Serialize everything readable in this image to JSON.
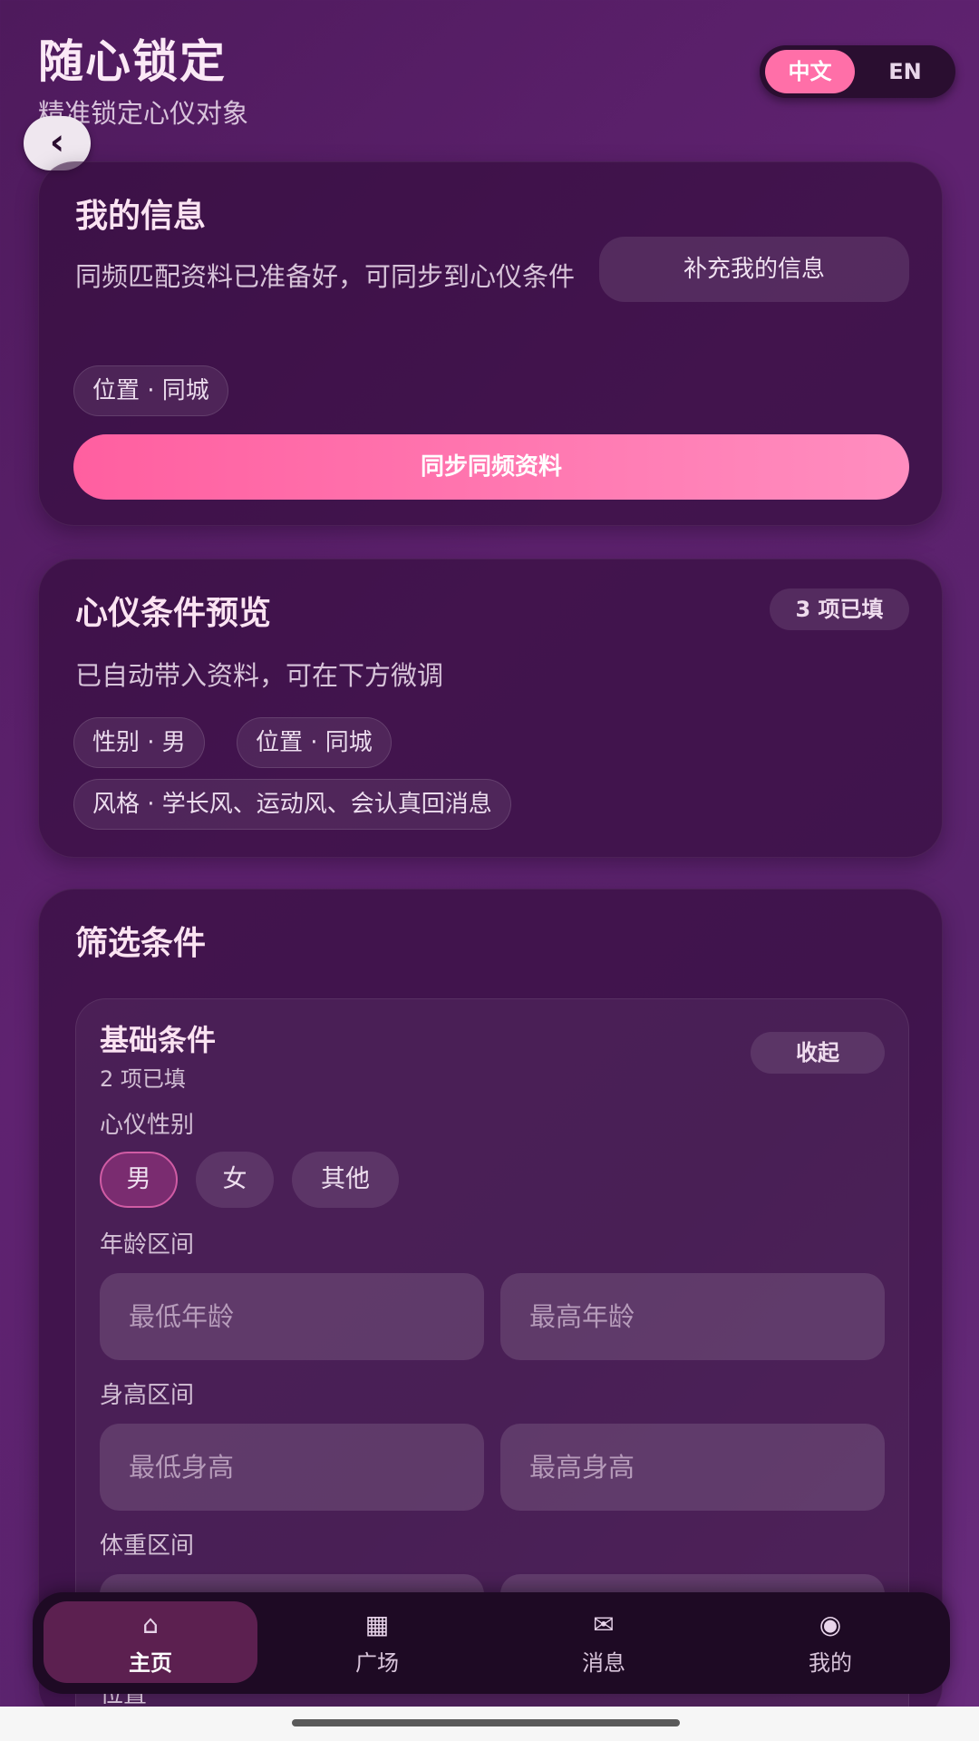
{
  "header": {
    "title": "随心锁定",
    "subtitle": "精准锁定心仪对象"
  },
  "lang": {
    "zh": "中文",
    "en": "EN",
    "active": "中文"
  },
  "back": {
    "icon": "chevron-left-icon",
    "glyph": "‹"
  },
  "my_info": {
    "title": "我的信息",
    "description": "同频匹配资料已准备好，可同步到心仪条件",
    "add_button": "补充我的信息",
    "chips": [
      "位置 · 同城"
    ],
    "sync_button": "同步同频资料"
  },
  "preview": {
    "title": "心仪条件预览",
    "badge": "3 项已填",
    "description": "已自动带入资料，可在下方微调",
    "chips": [
      "性别 · 男",
      "位置 · 同城",
      "风格 · 学长风、运动风、会认真回消息"
    ]
  },
  "filters": {
    "title": "筛选条件",
    "basic": {
      "title": "基础条件",
      "count": "2 项已填",
      "collapse": "收起",
      "gender_label": "心仪性别",
      "gender_options": [
        "男",
        "女",
        "其他"
      ],
      "gender_selected": "男",
      "age_label": "年龄区间",
      "age_min_placeholder": "最低年龄",
      "age_max_placeholder": "最高年龄",
      "height_label": "身高区间",
      "height_min_placeholder": "最低身高",
      "height_max_placeholder": "最高身高",
      "weight_label": "体重区间",
      "location_label": "位置"
    }
  },
  "nav": {
    "items": [
      {
        "label": "主页",
        "icon": "home-icon",
        "glyph": "⌂"
      },
      {
        "label": "广场",
        "icon": "grid-icon",
        "glyph": "▦"
      },
      {
        "label": "消息",
        "icon": "mail-icon",
        "glyph": "✉"
      },
      {
        "label": "我的",
        "icon": "profile-icon",
        "glyph": "◉"
      }
    ],
    "active": "主页"
  },
  "colors": {
    "accent": "#ff6fa8",
    "background": "#5f2270",
    "card": "#300c38"
  }
}
